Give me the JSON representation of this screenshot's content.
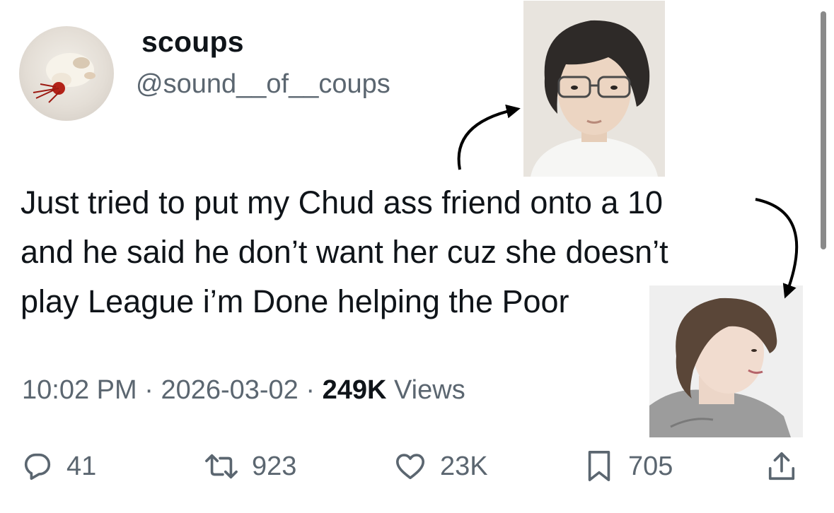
{
  "tweet": {
    "author": {
      "display_name": "scoups",
      "handle": "@sound__of__coups"
    },
    "text": "Just tried to put my Chud ass friend onto a 10\nand he said he don’t want her cuz she doesn’t\nplay League  i’m Done helping the Poor",
    "meta": {
      "time": "10:02 PM",
      "separator": "·",
      "date": "2026-03-02",
      "views_count": "249K",
      "views_label": "Views"
    },
    "actions": {
      "replies": "41",
      "retweets": "923",
      "likes": "23K",
      "bookmarks": "705"
    }
  },
  "colors": {
    "text_primary": "#0f1419",
    "text_secondary": "#5b6670",
    "background": "#ffffff",
    "scrollbar": "#8a8a8a"
  },
  "icons": [
    "reply-icon",
    "retweet-icon",
    "like-icon",
    "bookmark-icon",
    "share-icon"
  ]
}
